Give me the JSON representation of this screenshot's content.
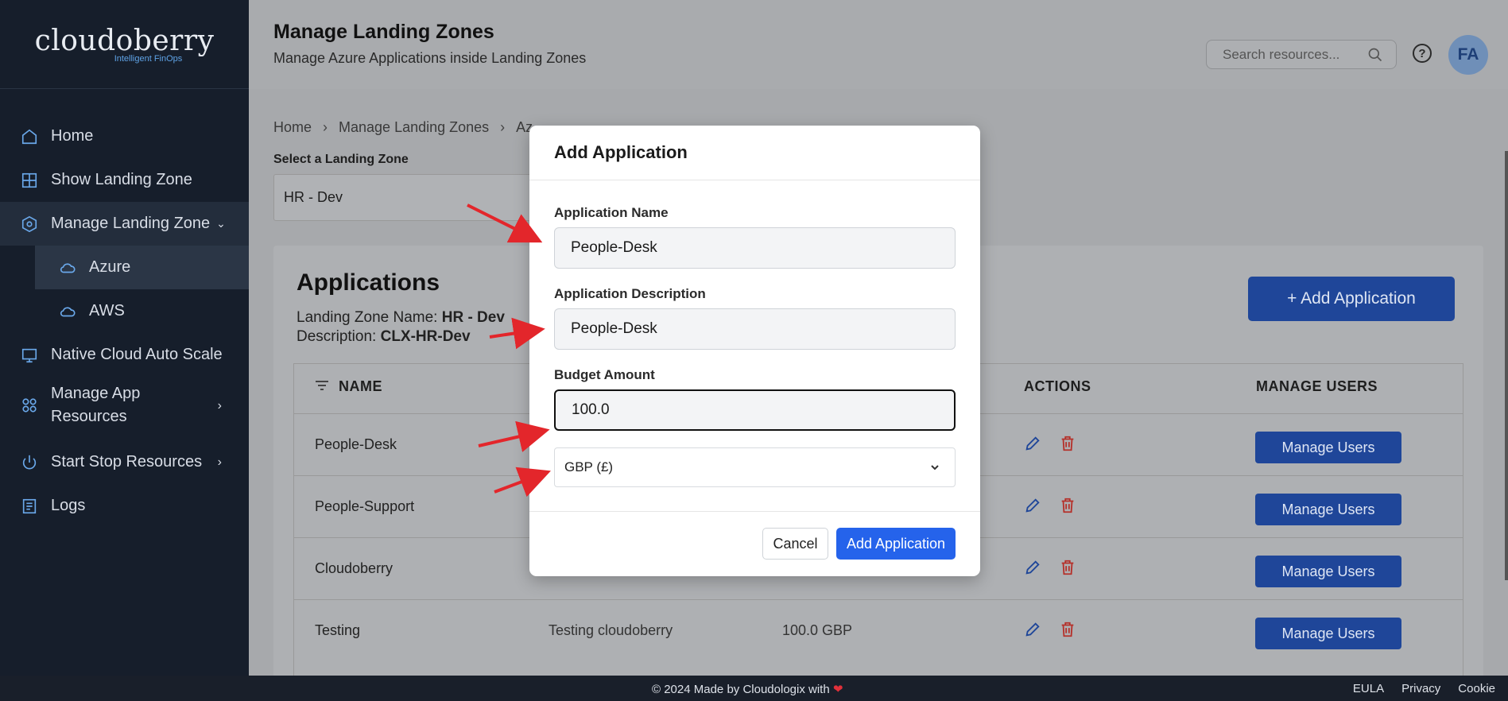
{
  "brand": {
    "name": "cloudoberry",
    "tagline": "Intelligent FinOps"
  },
  "sidebar": {
    "items": [
      {
        "label": "Home",
        "icon": "home-icon"
      },
      {
        "label": "Show Landing Zone",
        "icon": "grid-icon"
      },
      {
        "label": "Manage Landing Zone",
        "icon": "hexagon-icon",
        "expanded": true
      },
      {
        "label": "Azure",
        "icon": "cloud-icon",
        "active": true
      },
      {
        "label": "AWS",
        "icon": "cloud-icon"
      },
      {
        "label": "Native Cloud Auto Scale",
        "icon": "monitor-icon"
      },
      {
        "label": "Manage App Resources",
        "icon": "apps-icon"
      },
      {
        "label": "Start Stop Resources",
        "icon": "power-icon"
      },
      {
        "label": "Logs",
        "icon": "document-icon"
      }
    ]
  },
  "header": {
    "title": "Manage Landing Zones",
    "subtitle": "Manage Azure Applications inside Landing Zones",
    "search_placeholder": "Search resources...",
    "help": "?",
    "avatar": "FA"
  },
  "breadcrumb": [
    "Home",
    "Manage Landing Zones",
    "Az"
  ],
  "landing_zone": {
    "label": "Select a Landing Zone",
    "value": "HR - Dev"
  },
  "applications": {
    "title": "Applications",
    "zone_name_label": "Landing Zone Name:",
    "zone_name": "HR - Dev",
    "description_label": "Description:",
    "description": "CLX-HR-Dev",
    "add_button": "+ Add Application",
    "columns": [
      "NAME",
      "ACTIONS",
      "MANAGE USERS"
    ],
    "rows": [
      {
        "name": "People-Desk",
        "description": "",
        "budget": ""
      },
      {
        "name": "People-Support",
        "description": "",
        "budget": ""
      },
      {
        "name": "Cloudoberry",
        "description": "",
        "budget": ""
      },
      {
        "name": "Testing",
        "description": "Testing cloudoberry",
        "budget": "100.0 GBP"
      }
    ],
    "manage_users_label": "Manage Users"
  },
  "modal": {
    "title": "Add Application",
    "name_label": "Application Name",
    "name_value": "People-Desk",
    "desc_label": "Application Description",
    "desc_value": "People-Desk",
    "budget_label": "Budget Amount",
    "budget_value": "100.0",
    "currency_value": "GBP (£)",
    "cancel": "Cancel",
    "submit": "Add Application"
  },
  "footer": {
    "copyright": "© 2024 Made by Cloudologix with",
    "links": [
      "EULA",
      "Privacy",
      "Cookie"
    ]
  },
  "colors": {
    "sidebar_bg": "#161e2b",
    "accent": "#2563eb",
    "icon_blue": "#6aa8ea",
    "delete_red": "#c0392b",
    "arrow_red": "#e3262b"
  }
}
